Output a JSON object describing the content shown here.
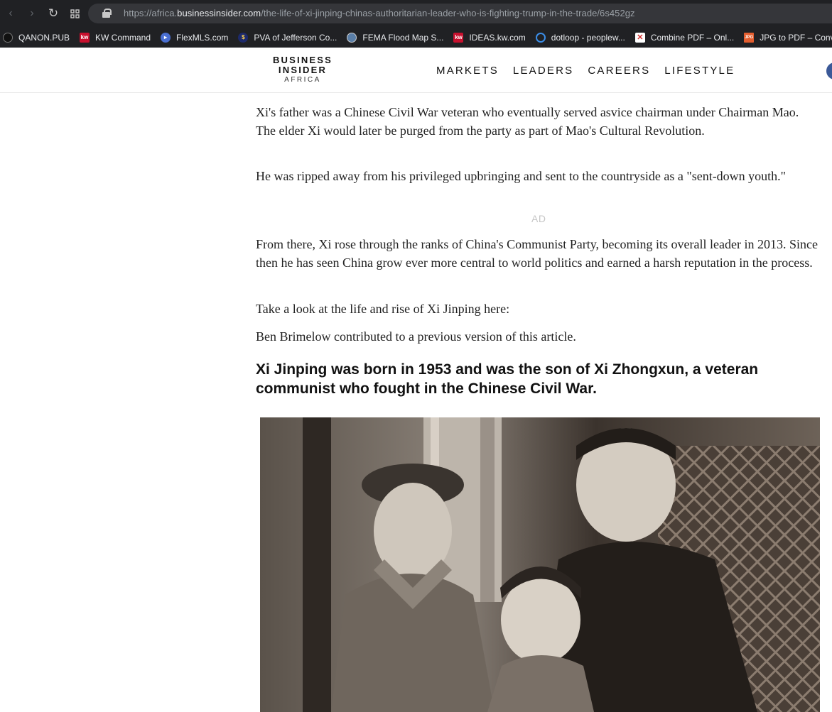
{
  "browser": {
    "url_prefix": "https://africa.",
    "url_domain": "businessinsider.com",
    "url_path": "/the-life-of-xi-jinping-chinas-authoritarian-leader-who-is-fighting-trump-in-the-trade/6s452gz",
    "bookmarks": [
      {
        "label": "QANON.PUB",
        "icon": "qanon-icon"
      },
      {
        "label": "KW Command",
        "icon": "kw-icon"
      },
      {
        "label": "FlexMLS.com",
        "icon": "flexmls-icon"
      },
      {
        "label": "PVA of Jefferson Co...",
        "icon": "pva-icon"
      },
      {
        "label": "FEMA Flood Map S...",
        "icon": "fema-seal-icon"
      },
      {
        "label": "IDEAS.kw.com",
        "icon": "kw-icon"
      },
      {
        "label": "dotloop - peoplew...",
        "icon": "dotloop-icon"
      },
      {
        "label": "Combine PDF – Onl...",
        "icon": "pdf-icon"
      },
      {
        "label": "JPG to PDF – Conve...",
        "icon": "jpg-pdf-icon"
      }
    ]
  },
  "site": {
    "logo_line1": "BUSINESS",
    "logo_line2": "INSIDER",
    "logo_line3": "AFRICA",
    "nav": [
      "MARKETS",
      "LEADERS",
      "CAREERS",
      "LIFESTYLE"
    ]
  },
  "article": {
    "paragraphs": [
      "Xi's father was a Chinese Civil War veteran who eventually served asvice chairman under Chairman Mao. The elder Xi would later be purged from the party as part of Mao's Cultural Revolution.",
      "He was ripped away from his privileged upbringing and sent to the countryside as a \"sent-down youth.\"",
      "From there, Xi rose through the ranks of China's Communist Party, becoming its overall leader in 2013. Since then he has seen China grow ever more central to world politics and earned a harsh reputation in the process.",
      "Take a look at the life and rise of Xi Jinping here:",
      "Ben Brimelow contributed to a previous version of this article."
    ],
    "ad_label": "AD",
    "headline": "Xi Jinping was born in 1953 and was the son of Xi Zhongxun, a veteran communist who fought in the Chinese Civil War."
  }
}
